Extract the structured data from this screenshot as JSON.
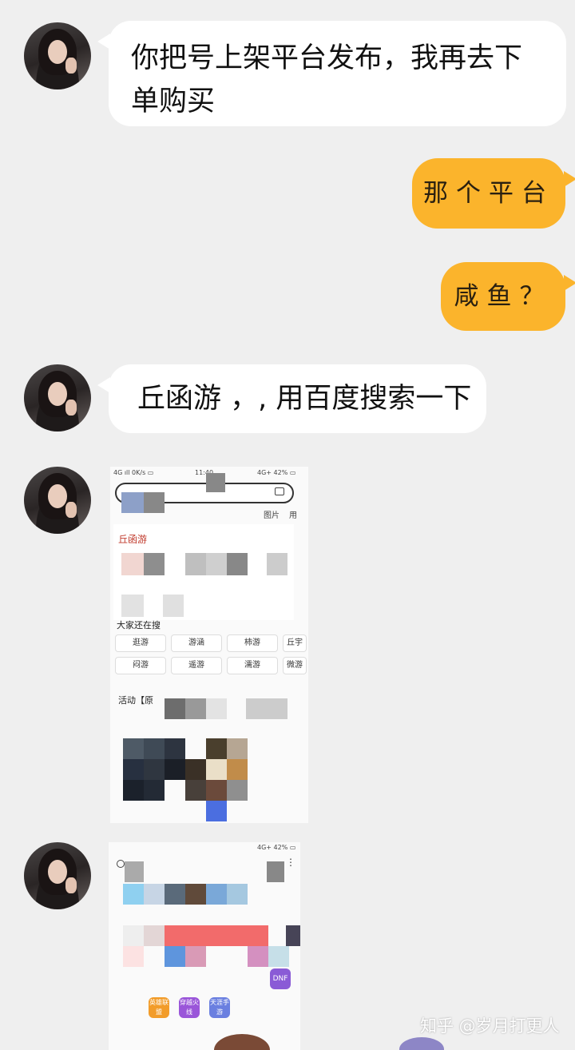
{
  "messages": {
    "m1": "你把号上架平台发布，我再去下单购买",
    "m2": "那个平台",
    "m3": "咸鱼？",
    "m4": "丘函游 ，, 用百度搜索一下"
  },
  "screenshot1": {
    "status_left": "4G ıll 0K/s ▭",
    "status_time": "11:40",
    "status_right": "4G+ 42% ▭",
    "tab_images": "图片",
    "tab_more": "用",
    "result_title": "丘函游",
    "suggest_heading": "大家还在搜",
    "chips": [
      "逛游",
      "游涵",
      "柿游",
      "丘宇",
      "闷游",
      "遥游",
      "濡游",
      "微游"
    ],
    "activity_label": "活动【原"
  },
  "screenshot2": {
    "status_right": "4G+ 42% ▭",
    "apps": [
      {
        "label": "DNF",
        "color": "#8a5bd6"
      },
      {
        "label": "英雄联盟",
        "color": "#f29c2a"
      },
      {
        "label": "穿越火线",
        "color": "#9a56d9"
      },
      {
        "label": "天涯手游",
        "color": "#6a7fe0"
      }
    ]
  },
  "watermark": "知乎 @岁月打更人"
}
